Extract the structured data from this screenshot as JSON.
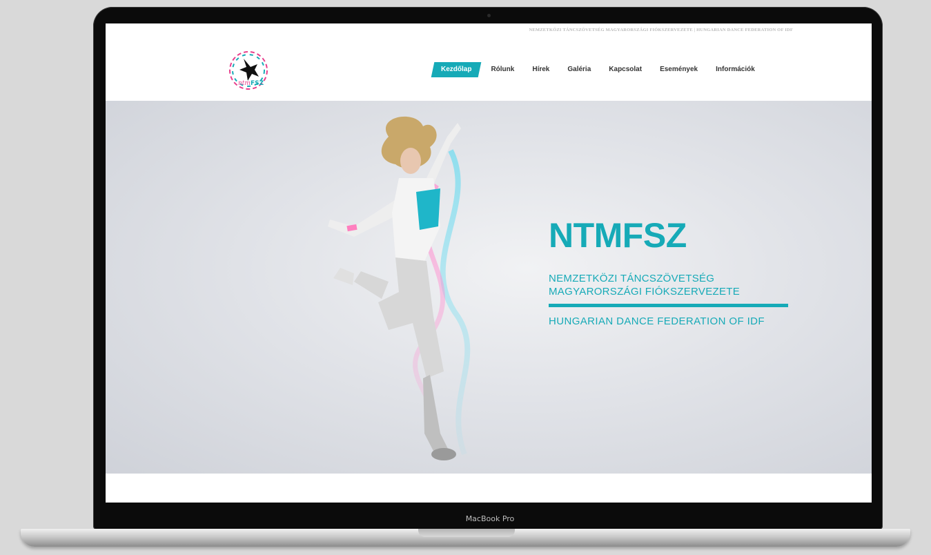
{
  "device": {
    "model_label": "MacBook Pro"
  },
  "site": {
    "topbar_text": "NEMZETKÖZI TÁNCSZÖVETSÉG MAGYARORSZÁGI FIÓKSZERVEZETE | HUNGARIAN DANCE FEDERATION OF IDF",
    "logo_name": "ntmfsz-logo",
    "nav": [
      {
        "label": "Kezdőlap",
        "active": true
      },
      {
        "label": "Rólunk"
      },
      {
        "label": "Hírek"
      },
      {
        "label": "Galéria"
      },
      {
        "label": "Kapcsolat"
      },
      {
        "label": "Események"
      },
      {
        "label": "Információk"
      }
    ],
    "hero": {
      "title": "NTMFSZ",
      "subtitle_line1": "NEMZETKÖZI TÁNCSZÖVETSÉG",
      "subtitle_line2": "MAGYARORSZÁGI FIÓKSZERVEZETE",
      "subtitle_en": "HUNGARIAN DANCE FEDERATION OF IDF"
    },
    "colors": {
      "accent": "#16aab7",
      "nav_text": "#333333"
    }
  }
}
